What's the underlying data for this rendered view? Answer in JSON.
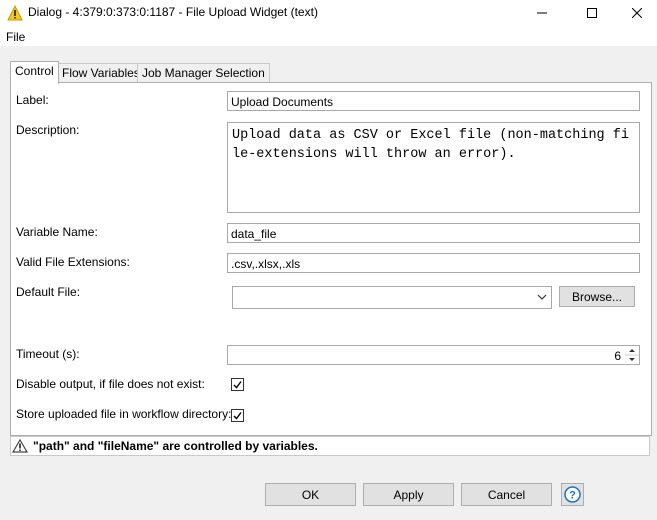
{
  "window": {
    "title": "Dialog - 4:379:0:373:0:1187 - File Upload Widget (text)",
    "minimize_icon": "minimize-icon",
    "maximize_icon": "maximize-icon",
    "close_icon": "close-icon"
  },
  "menu": {
    "file": "File"
  },
  "tabs": [
    {
      "label": "Control",
      "active": true
    },
    {
      "label": "Flow Variables",
      "active": false
    },
    {
      "label": "Job Manager Selection",
      "active": false
    }
  ],
  "form": {
    "label_label": "Label:",
    "label_value": "Upload Documents",
    "description_label": "Description:",
    "description_value": "Upload data as CSV or Excel file (non-matching file-extensions will throw an error).",
    "variable_name_label": "Variable Name:",
    "variable_name_value": "data_file",
    "extensions_label": "Valid File Extensions:",
    "extensions_value": ".csv,.xlsx,.xls",
    "default_file_label": "Default File:",
    "default_file_value": "",
    "browse_label": "Browse...",
    "timeout_label": "Timeout (s):",
    "timeout_value": "6",
    "disable_output_label": "Disable output, if file does not exist:",
    "disable_output_checked": true,
    "store_uploaded_label": "Store uploaded file in workflow directory:",
    "store_uploaded_checked": true
  },
  "warning": {
    "text": "\"path\" and \"fileName\" are controlled by variables."
  },
  "buttons": {
    "ok": "OK",
    "apply": "Apply",
    "cancel": "Cancel",
    "help_icon": "help-icon"
  },
  "colors": {
    "accent": "#0078d7",
    "warning": "#f5c518",
    "help_blue": "#1e73be"
  }
}
